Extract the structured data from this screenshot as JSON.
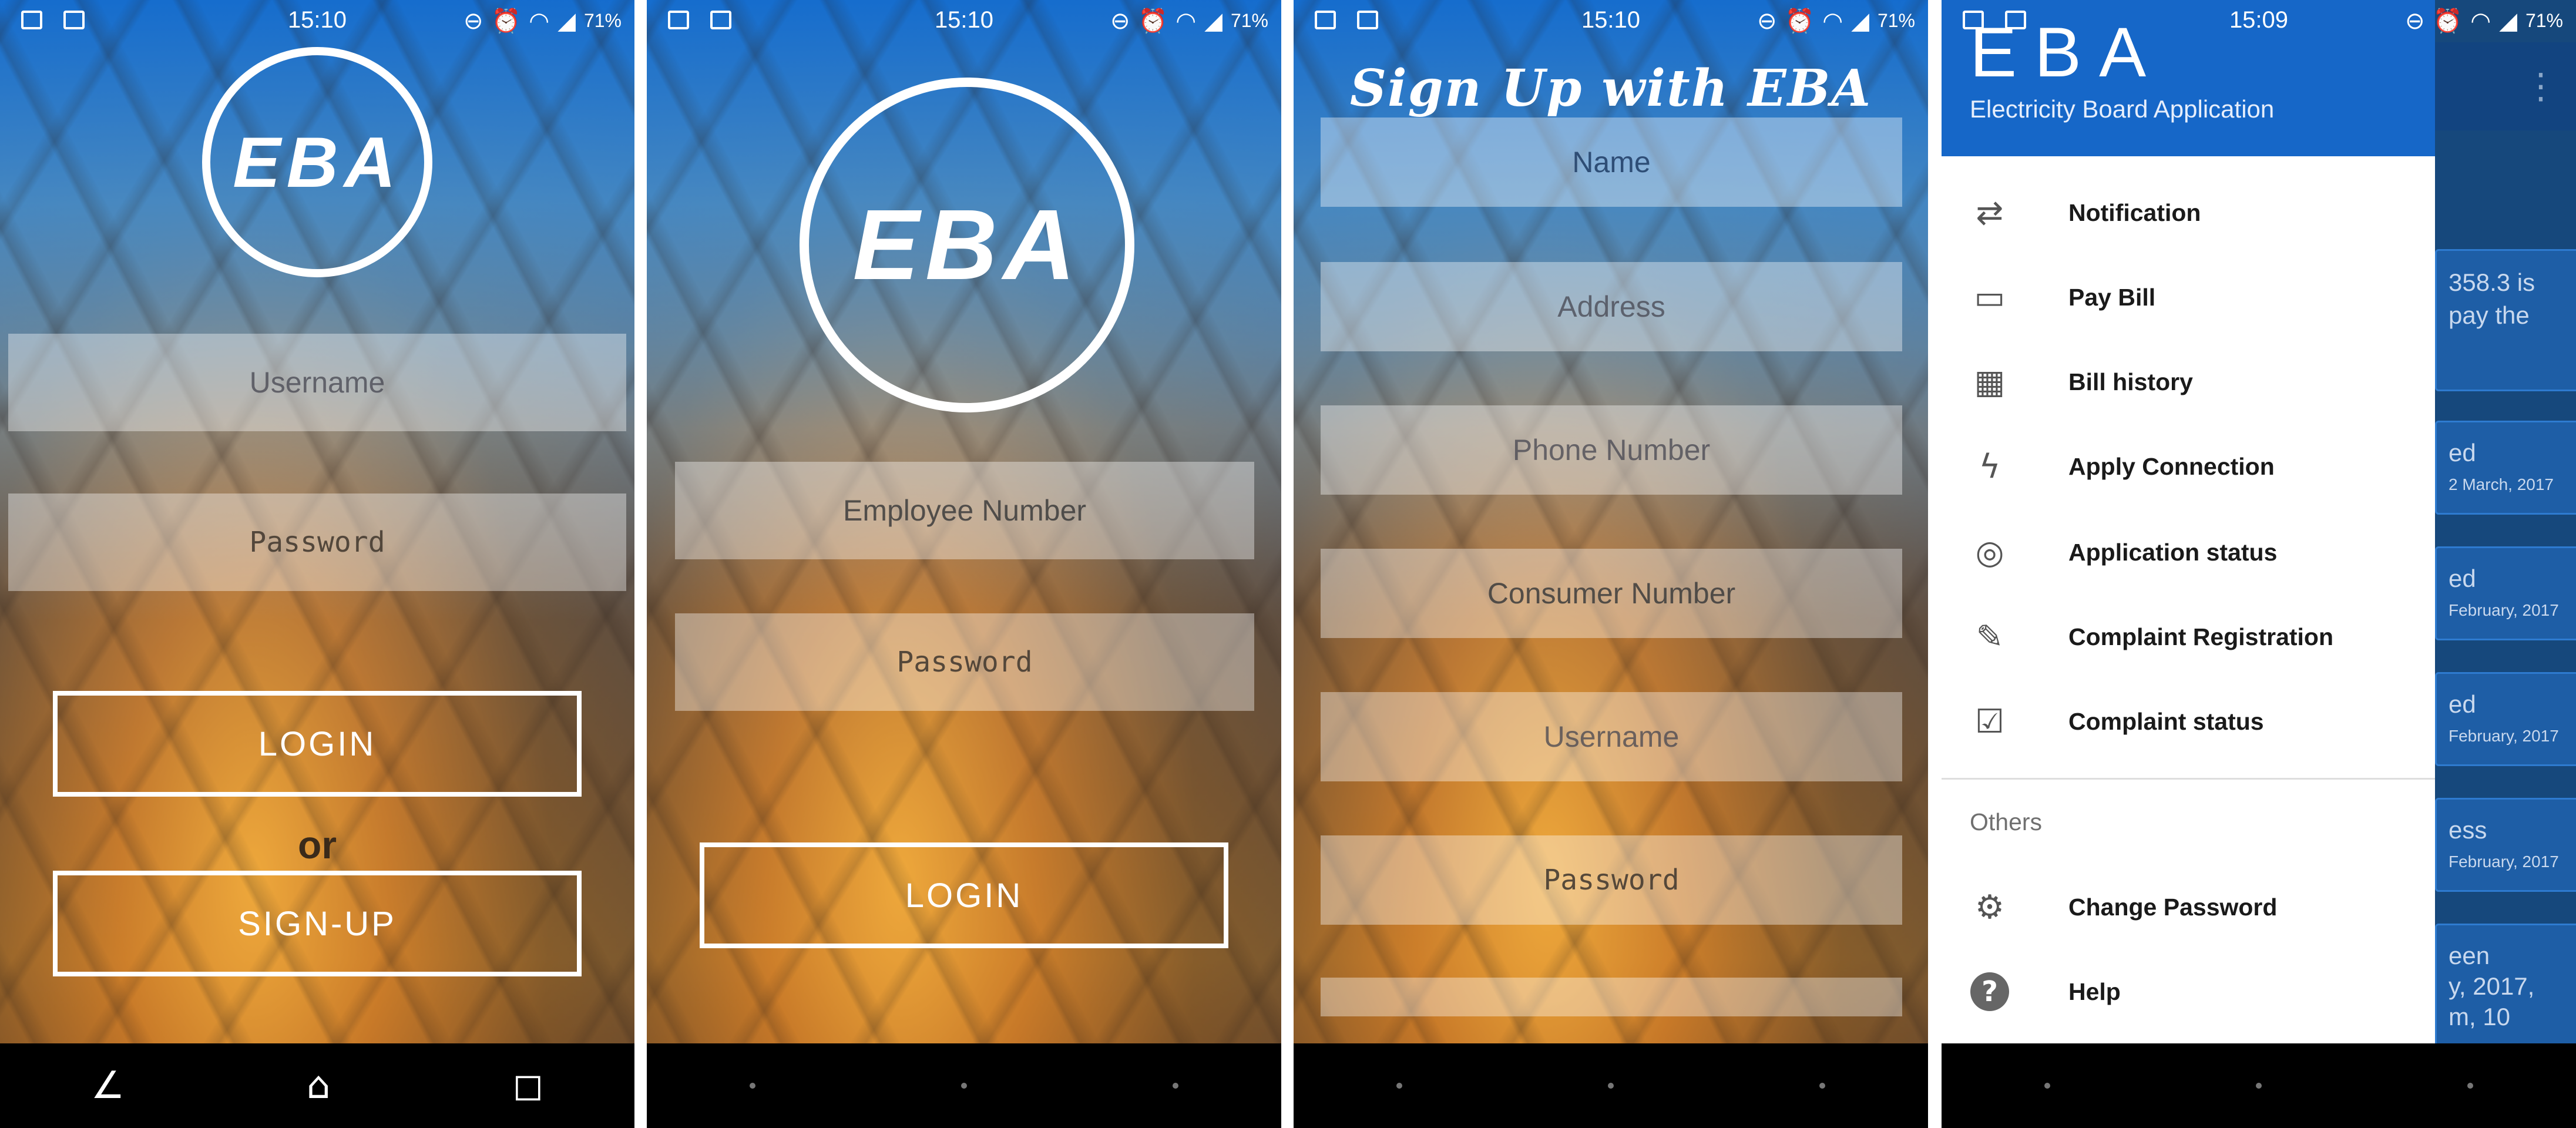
{
  "screens": [
    {
      "status": {
        "time": "15:10",
        "battery": "71%"
      },
      "logo": "EBA",
      "username_placeholder": "Username",
      "password_placeholder": "Password",
      "login_label": "LOGIN",
      "or_label": "or",
      "signup_label": "SIGN-UP"
    },
    {
      "status": {
        "time": "15:10",
        "battery": "71%"
      },
      "logo": "EBA",
      "employee_placeholder": "Employee Number",
      "password_placeholder": "Password",
      "login_label": "LOGIN"
    },
    {
      "status": {
        "time": "15:10",
        "battery": "71%"
      },
      "title": "Sign Up with EBA",
      "fields": [
        "Name",
        "Address",
        "Phone Number",
        "Consumer Number",
        "Username",
        "Password"
      ]
    },
    {
      "status": {
        "time": "15:09",
        "battery": "71%"
      },
      "drawer": {
        "brand": "EBA",
        "subtitle": "Electricity Board Application",
        "items": [
          {
            "label": "Notification",
            "icon": "refresh-icon"
          },
          {
            "label": "Pay Bill",
            "icon": "pay-card-icon"
          },
          {
            "label": "Bill history",
            "icon": "calculator-icon"
          },
          {
            "label": "Apply Connection",
            "icon": "bolt-icon"
          },
          {
            "label": "Application status",
            "icon": "search-status-icon"
          },
          {
            "label": "Complaint Registration",
            "icon": "document-edit-icon"
          },
          {
            "label": "Complaint status",
            "icon": "clipboard-check-icon"
          }
        ],
        "section_others": "Others",
        "others": [
          {
            "label": "Change Password",
            "icon": "gear-icon"
          },
          {
            "label": "Help",
            "icon": "help-icon"
          }
        ]
      },
      "background_cards": [
        {
          "line1": "358.3 is",
          "line2": "pay the"
        },
        {
          "line1": "ed",
          "line2": "2 March, 2017"
        },
        {
          "line1": "ed",
          "line2": "February, 2017"
        },
        {
          "line1": "ed",
          "line2": "February, 2017"
        },
        {
          "line1": "ess",
          "line2": "February, 2017"
        },
        {
          "line1": "een",
          "line2": "y, 2017,",
          "line3": "m, 10"
        }
      ]
    }
  ]
}
